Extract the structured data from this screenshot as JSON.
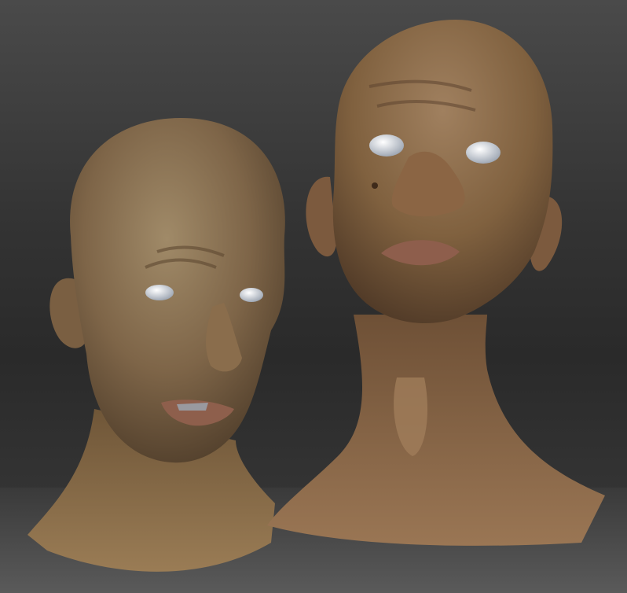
{
  "viewport": {
    "background_top": "#4a4a4a",
    "background_bottom": "#2a2a2a",
    "ground_color": "#5a5a5a"
  },
  "sculpts": [
    {
      "id": "head-left",
      "skin_color": "#8a7152",
      "expression": "grimace",
      "eyes": "blank-white"
    },
    {
      "id": "head-right",
      "skin_color": "#8b6a4e",
      "expression": "pout",
      "eyes": "blank-white"
    }
  ]
}
